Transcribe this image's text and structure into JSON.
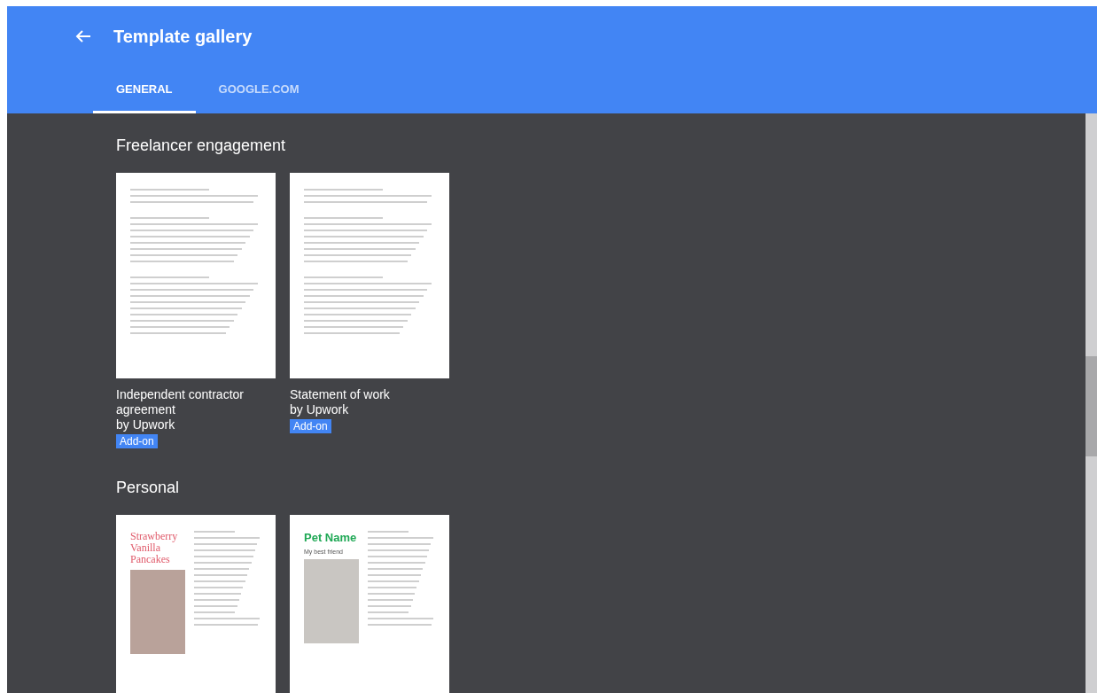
{
  "header": {
    "title": "Template gallery"
  },
  "tabs": [
    {
      "label": "GENERAL",
      "selected": true
    },
    {
      "label": "GOOGLE.COM",
      "selected": false
    }
  ],
  "sections": [
    {
      "title": "Freelancer engagement",
      "templates": [
        {
          "kind": "document",
          "name": "Independent contractor agreement",
          "author": "by Upwork",
          "badge": "Add-on"
        },
        {
          "kind": "document",
          "name": "Statement of work",
          "author": "by Upwork",
          "badge": "Add-on"
        }
      ]
    },
    {
      "title": "Personal",
      "templates": [
        {
          "kind": "recipe",
          "preview_title": "Strawberry Vanilla Pancakes"
        },
        {
          "kind": "pet",
          "preview_title": "Pet Name",
          "preview_subtitle": "My best friend"
        }
      ]
    }
  ]
}
